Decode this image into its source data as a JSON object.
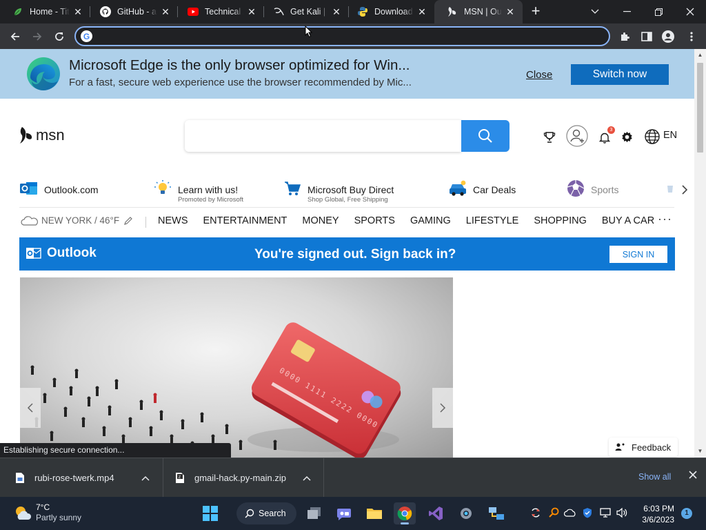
{
  "browser": {
    "tabs": [
      {
        "title": "Home - Tita",
        "icon": "leaf-favicon-icon",
        "active": false
      },
      {
        "title": "GitHub - ak",
        "icon": "github-icon",
        "active": false
      },
      {
        "title": "Technical A",
        "icon": "youtube-icon",
        "active": false
      },
      {
        "title": "Get Kali | K",
        "icon": "kali-dragon-icon",
        "active": false
      },
      {
        "title": "Download",
        "icon": "python-icon",
        "active": false
      },
      {
        "title": "MSN | Outl",
        "icon": "msn-butterfly-icon",
        "active": true
      }
    ],
    "address": {
      "value": ""
    }
  },
  "edge_banner": {
    "title": "Microsoft Edge is the only browser optimized for Win...",
    "subtitle": "For a fast, secure web experience use the browser recommended by Mic...",
    "close_label": "Close",
    "switch_label": "Switch now"
  },
  "msn_header": {
    "logo_text": "msn",
    "search": {
      "placeholder": "",
      "value": ""
    },
    "notification_count": "3",
    "language": "EN"
  },
  "promo_links": [
    {
      "label": "Outlook.com",
      "sub": "",
      "icon": "outlook-icon"
    },
    {
      "label": "Learn with us!",
      "sub": "Promoted by Microsoft",
      "icon": "lightbulb-icon"
    },
    {
      "label": "Microsoft Buy Direct",
      "sub": "Shop Global, Free Shipping",
      "icon": "shopping-cart-icon"
    },
    {
      "label": "Car Deals",
      "sub": "",
      "icon": "car-icon"
    },
    {
      "label": "Sports",
      "sub": "",
      "icon": "sports-ball-icon"
    }
  ],
  "nav": {
    "weather": "NEW YORK / 46°F",
    "items": [
      "NEWS",
      "ENTERTAINMENT",
      "MONEY",
      "SPORTS",
      "GAMING",
      "LIFESTYLE",
      "SHOPPING",
      "BUY A CAR"
    ],
    "more": "···"
  },
  "outlook_bar": {
    "brand": "Outlook",
    "message": "You're signed out. Sign back in?",
    "signin_label": "SIGN IN"
  },
  "feedback_label": "Feedback",
  "status_bubble": "Establishing secure connection...",
  "downloads": {
    "items": [
      {
        "name": "rubi-rose-twerk.mp4",
        "icon": "video-file-icon"
      },
      {
        "name": "gmail-hack.py-main.zip",
        "icon": "zip-file-icon"
      }
    ],
    "show_all": "Show all"
  },
  "taskbar": {
    "weather_temp": "7°C",
    "weather_cond": "Partly sunny",
    "search_label": "Search",
    "time": "6:03 PM",
    "date": "3/6/2023",
    "notification_count": "1"
  },
  "colors": {
    "edge_banner_bg": "#aed0ea",
    "switch_button": "#0f6cbd",
    "search_button": "#2b8ce8",
    "outlook_bar": "#0f78d4",
    "chrome_dark": "#202124"
  }
}
